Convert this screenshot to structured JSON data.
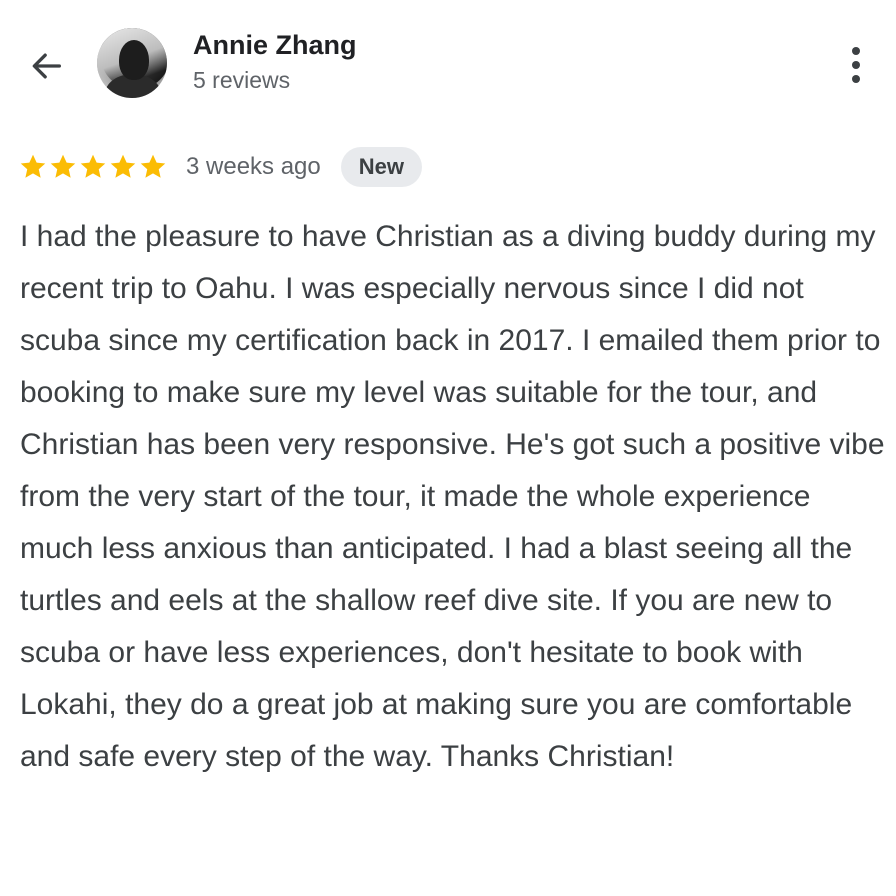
{
  "header": {
    "back_icon": "arrow-left-icon",
    "reviewer_name": "Annie Zhang",
    "review_count": "5 reviews",
    "more_icon": "more-vertical-icon"
  },
  "review": {
    "rating": 5,
    "max_rating": 5,
    "star_color": "#fbbc04",
    "date": "3 weeks ago",
    "badge": "New",
    "text": "I had the pleasure to have Christian as a diving buddy during my recent trip to Oahu. I was especially nervous since I did not scuba since my certification back in 2017. I emailed them prior to booking to make sure my level was suitable for the tour, and Christian has been very responsive. He's got such a positive vibe from the very start of the tour, it made the whole experience much less anxious than anticipated. I had a blast seeing all the turtles and eels at the shallow reef dive site. If you are new to scuba or have less experiences, don't hesitate to book with Lokahi, they do a great job at making sure you are comfortable and safe every step of the way. Thanks Christian!"
  }
}
